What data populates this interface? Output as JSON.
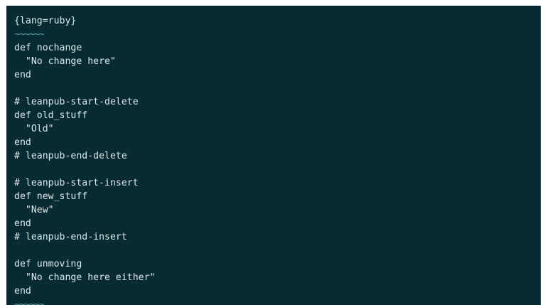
{
  "editor": {
    "lines": [
      "{lang=ruby}",
      "~~~~~~",
      "def nochange",
      "  \"No change here\"",
      "end",
      "",
      "# leanpub-start-delete",
      "def old_stuff",
      "  \"Old\"",
      "end",
      "# leanpub-end-delete",
      "",
      "# leanpub-start-insert",
      "def new_stuff",
      "  \"New\"",
      "end",
      "# leanpub-end-insert",
      "",
      "def unmoving",
      "  \"No change here either\"",
      "end",
      "~~~~~~"
    ]
  },
  "colors": {
    "background": "#062b32",
    "text": "#dfe6e8",
    "fence": "#5aa0aa"
  }
}
